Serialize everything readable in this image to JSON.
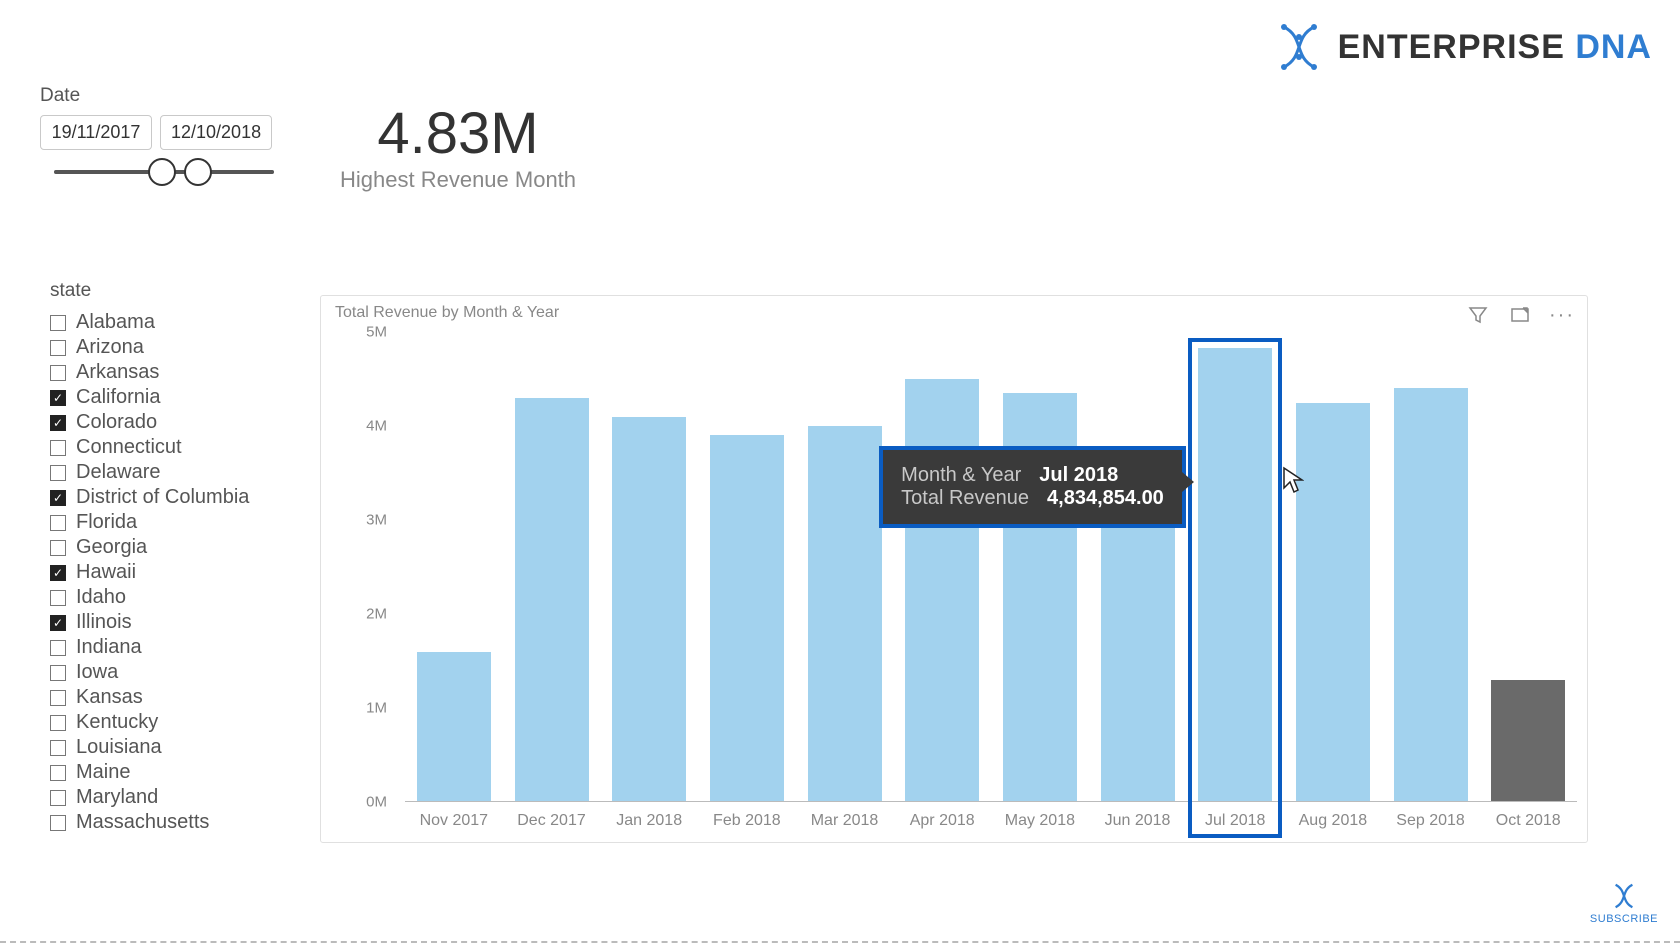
{
  "logo": {
    "text1": "ENTERPRISE",
    "text2": "DNA"
  },
  "date_slicer": {
    "title": "Date",
    "from": "19/11/2017",
    "to": "12/10/2018"
  },
  "card": {
    "value": "4.83M",
    "label": "Highest Revenue Month"
  },
  "state_slicer": {
    "title": "state",
    "items": [
      {
        "label": "Alabama",
        "checked": false
      },
      {
        "label": "Arizona",
        "checked": false
      },
      {
        "label": "Arkansas",
        "checked": false
      },
      {
        "label": "California",
        "checked": true
      },
      {
        "label": "Colorado",
        "checked": true
      },
      {
        "label": "Connecticut",
        "checked": false
      },
      {
        "label": "Delaware",
        "checked": false
      },
      {
        "label": "District of Columbia",
        "checked": true
      },
      {
        "label": "Florida",
        "checked": false
      },
      {
        "label": "Georgia",
        "checked": false
      },
      {
        "label": "Hawaii",
        "checked": true
      },
      {
        "label": "Idaho",
        "checked": false
      },
      {
        "label": "Illinois",
        "checked": true
      },
      {
        "label": "Indiana",
        "checked": false
      },
      {
        "label": "Iowa",
        "checked": false
      },
      {
        "label": "Kansas",
        "checked": false
      },
      {
        "label": "Kentucky",
        "checked": false
      },
      {
        "label": "Louisiana",
        "checked": false
      },
      {
        "label": "Maine",
        "checked": false
      },
      {
        "label": "Maryland",
        "checked": false
      },
      {
        "label": "Massachusetts",
        "checked": false
      }
    ]
  },
  "visual": {
    "title": "Total Revenue by Month & Year"
  },
  "tooltip": {
    "row1_label": "Month & Year",
    "row1_value": "Jul 2018",
    "row2_label": "Total Revenue",
    "row2_value": "4,834,854.00"
  },
  "subscribe": "SUBSCRIBE",
  "chart_data": {
    "type": "bar",
    "title": "Total Revenue by Month & Year",
    "xlabel": "",
    "ylabel": "",
    "ylim": [
      0,
      5000000
    ],
    "y_tick_labels": [
      "0M",
      "1M",
      "2M",
      "3M",
      "4M",
      "5M"
    ],
    "categories": [
      "Nov 2017",
      "Dec 2017",
      "Jan 2018",
      "Feb 2018",
      "Mar 2018",
      "Apr 2018",
      "May 2018",
      "Jun 2018",
      "Jul 2018",
      "Aug 2018",
      "Sep 2018",
      "Oct 2018"
    ],
    "values": [
      1600000,
      4300000,
      4100000,
      3900000,
      4000000,
      4500000,
      4350000,
      3600000,
      4834854,
      4250000,
      4400000,
      1300000
    ],
    "highlight_category": "Jul 2018",
    "gray_category": "Oct 2018"
  }
}
